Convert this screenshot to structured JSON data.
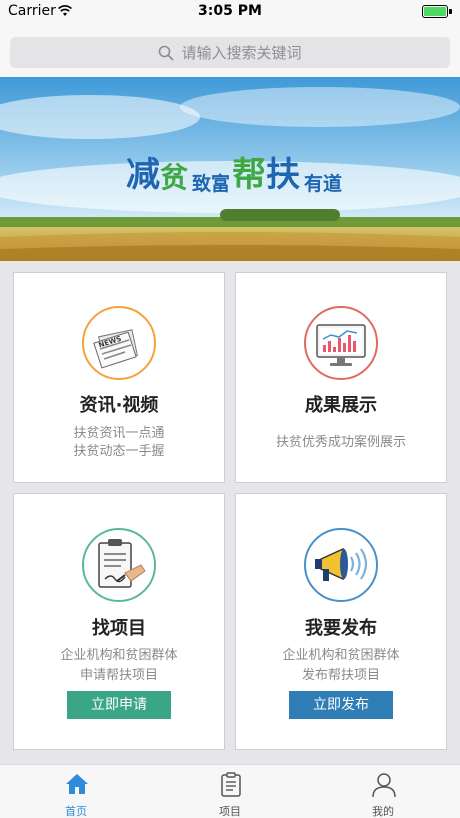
{
  "status_bar": {
    "carrier": "Carrier",
    "time": "3:05 PM"
  },
  "search": {
    "placeholder": "请输入搜索关键词"
  },
  "banner": {
    "slogan": [
      "减",
      "贫",
      "致富",
      "帮",
      "扶",
      "有道"
    ]
  },
  "cards": [
    {
      "title": "资讯·视频",
      "desc": [
        "扶贫资讯一点通",
        "扶贫动态一手握"
      ],
      "icon": "newspaper-icon"
    },
    {
      "title": "成果展示",
      "desc": [
        "扶贫优秀成功案例展示"
      ],
      "icon": "monitor-chart-icon"
    },
    {
      "title": "找项目",
      "desc": [
        "企业机构和贫困群体",
        "申请帮扶项目"
      ],
      "button": "立即申请",
      "button_color": "#3aa685",
      "icon": "clipboard-sign-icon"
    },
    {
      "title": "我要发布",
      "desc": [
        "企业机构和贫困群体",
        "发布帮扶项目"
      ],
      "button": "立即发布",
      "button_color": "#2e7db5",
      "icon": "megaphone-icon"
    }
  ],
  "tabbar": {
    "active_color": "#2f8ad8",
    "inactive_color": "#555555",
    "tabs": [
      {
        "label": "首页",
        "icon": "home-icon",
        "active": true
      },
      {
        "label": "项目",
        "icon": "clipboard-icon",
        "active": false
      },
      {
        "label": "我的",
        "icon": "user-icon",
        "active": false
      }
    ]
  }
}
